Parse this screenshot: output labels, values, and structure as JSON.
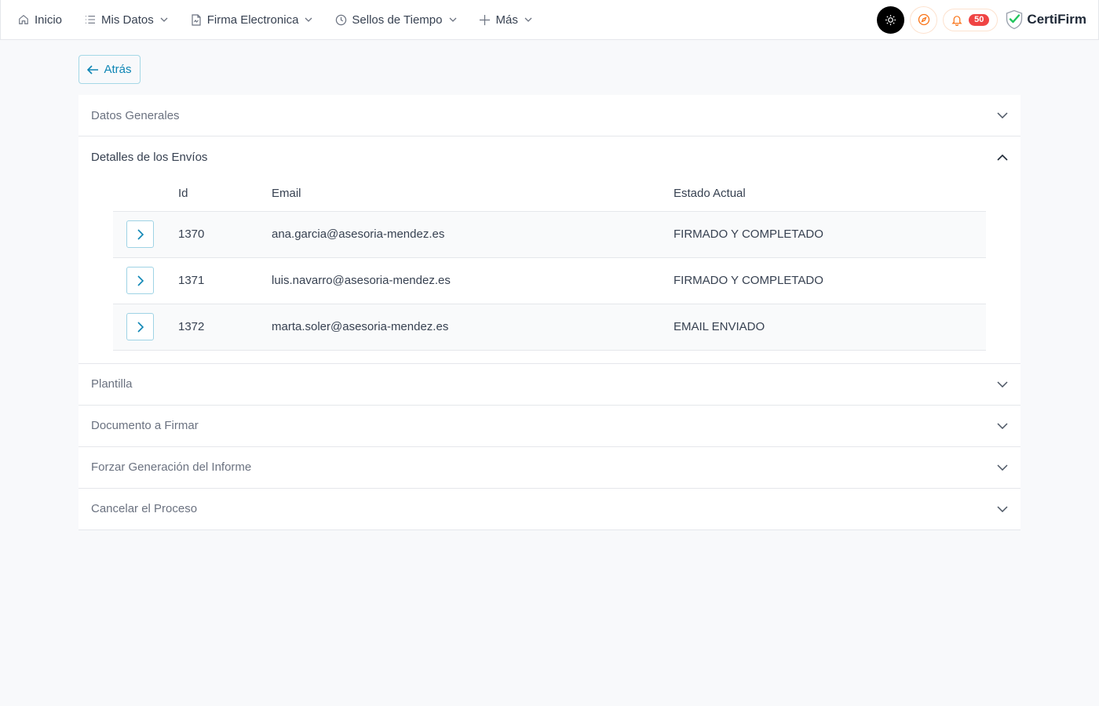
{
  "navbar": {
    "items": [
      {
        "label": "Inicio",
        "icon": "home-icon"
      },
      {
        "label": "Mis Datos",
        "icon": "list-icon"
      },
      {
        "label": "Firma Electronica",
        "icon": "document-icon"
      },
      {
        "label": "Sellos de Tiempo",
        "icon": "clock-icon"
      },
      {
        "label": "Más",
        "icon": "plus-icon"
      }
    ],
    "notifications_count": "50",
    "brand": "CertiFirm"
  },
  "back_label": "Atrás",
  "sections": {
    "datos_generales": "Datos Generales",
    "detalles_envios": "Detalles de los Envíos",
    "plantilla": "Plantilla",
    "documento": "Documento a Firmar",
    "forzar": "Forzar Generación del Informe",
    "cancelar": "Cancelar el Proceso"
  },
  "table": {
    "headers": {
      "id": "Id",
      "email": "Email",
      "estado": "Estado Actual"
    },
    "rows": [
      {
        "id": "1370",
        "email": "ana.garcia@asesoria-mendez.es",
        "estado": "FIRMADO Y COMPLETADO"
      },
      {
        "id": "1371",
        "email": "luis.navarro@asesoria-mendez.es",
        "estado": "FIRMADO Y COMPLETADO"
      },
      {
        "id": "1372",
        "email": "marta.soler@asesoria-mendez.es",
        "estado": "EMAIL ENVIADO"
      }
    ]
  },
  "colors": {
    "accent": "#0e86b5",
    "badge": "#ef4444",
    "brand_check": "#22c55e"
  }
}
